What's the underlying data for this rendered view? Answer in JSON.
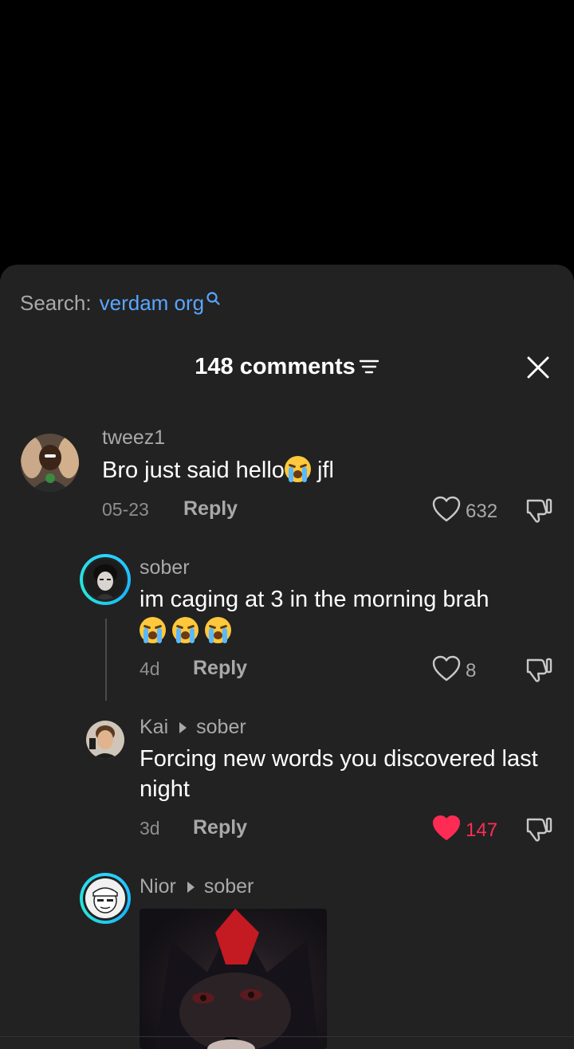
{
  "search": {
    "label": "Search:",
    "query": "verdam org"
  },
  "header": {
    "title": "148 comments"
  },
  "comments": [
    {
      "username": "tweez1",
      "text_before": "Bro just said hello",
      "text_after": " jfl",
      "date": "05-23",
      "reply_label": "Reply",
      "likes": "632",
      "liked": false
    },
    {
      "username": "sober",
      "text": "im caging at 3 in the morning brah",
      "date": "4d",
      "reply_label": "Reply",
      "likes": "8",
      "liked": false
    },
    {
      "username": "Kai",
      "reply_to": "sober",
      "text": "Forcing new words you discovered last night",
      "date": "3d",
      "reply_label": "Reply",
      "likes": "147",
      "liked": true
    },
    {
      "username": "Nior",
      "reply_to": "sober"
    }
  ],
  "colors": {
    "accent": "#5aa6ff",
    "liked": "#fe2c55",
    "sheet": "#222222"
  }
}
